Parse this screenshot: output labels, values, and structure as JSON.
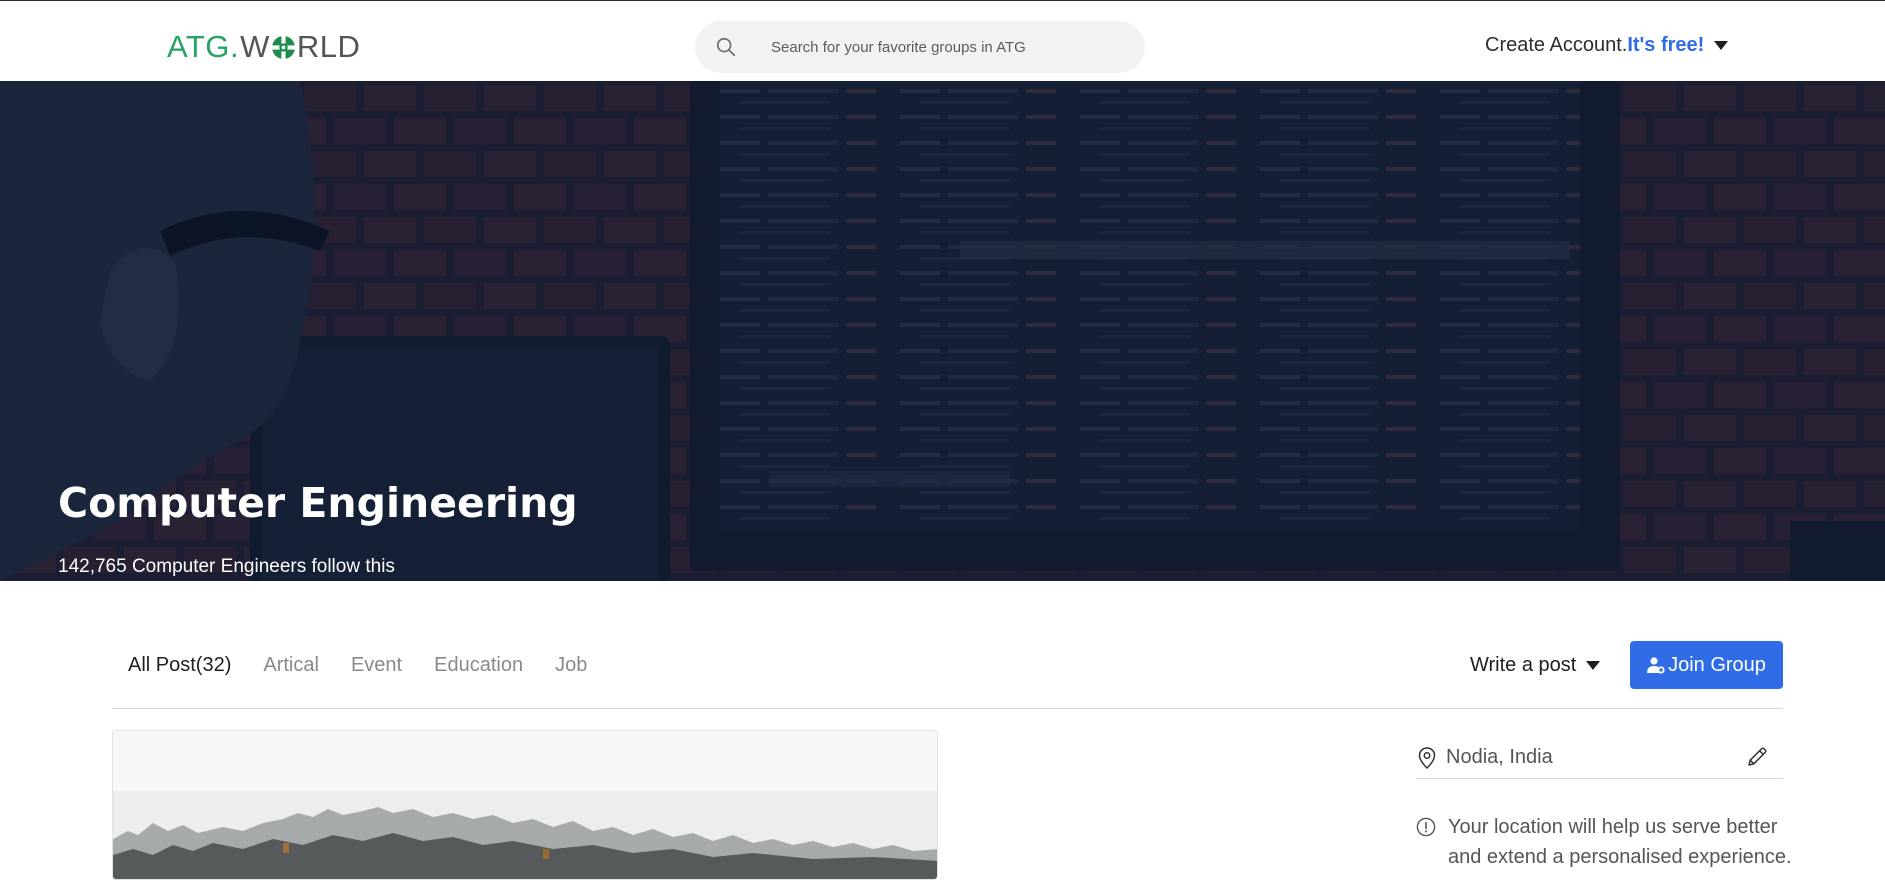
{
  "header": {
    "logo": {
      "part1": "ATG",
      "dot": ".",
      "w": "W",
      "part2": "RLD"
    },
    "search": {
      "placeholder": "Search for your favorite groups in ATG",
      "value": ""
    },
    "account": {
      "label": "Create Account.",
      "emphasis": "It's free!"
    }
  },
  "hero": {
    "title": "Computer Engineering",
    "subtitle": "142,765 Computer Engineers follow this"
  },
  "tabs": [
    {
      "label": "All Post(32)",
      "active": true
    },
    {
      "label": "Artical",
      "active": false
    },
    {
      "label": "Event",
      "active": false
    },
    {
      "label": "Education",
      "active": false
    },
    {
      "label": "Job",
      "active": false
    }
  ],
  "actions": {
    "write_post": "Write a post",
    "join_group": "Join Group"
  },
  "sidebar": {
    "location": "Nodia, India",
    "location_note": "Your location will help us serve better and extend a personalised experience."
  },
  "colors": {
    "accent": "#2f6ce5",
    "brand_green": "#27a365"
  },
  "icons": {
    "search": "search-icon",
    "caret": "caret-down-icon",
    "join": "user-plus-icon",
    "location": "map-pin-icon",
    "edit": "pencil-icon",
    "info": "info-circle-icon"
  }
}
